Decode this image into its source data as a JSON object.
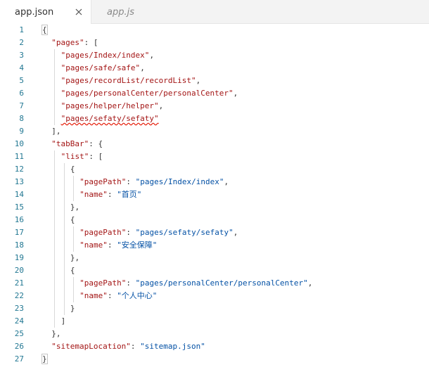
{
  "tabs": [
    {
      "label": "app.json",
      "active": true
    },
    {
      "label": "app.js",
      "active": false
    }
  ],
  "lines": [
    {
      "n": "1",
      "indent": 0,
      "tokens": [
        {
          "t": "{",
          "c": "punc",
          "box": true
        }
      ]
    },
    {
      "n": "2",
      "indent": 1,
      "tokens": [
        {
          "t": "\"pages\"",
          "c": "key"
        },
        {
          "t": ": [",
          "c": "punc"
        }
      ]
    },
    {
      "n": "3",
      "indent": 2,
      "tokens": [
        {
          "t": "\"pages/Index/index\"",
          "c": "key"
        },
        {
          "t": ",",
          "c": "punc"
        }
      ]
    },
    {
      "n": "4",
      "indent": 2,
      "tokens": [
        {
          "t": "\"pages/safe/safe\"",
          "c": "key"
        },
        {
          "t": ",",
          "c": "punc"
        }
      ]
    },
    {
      "n": "5",
      "indent": 2,
      "tokens": [
        {
          "t": "\"pages/recordList/recordList\"",
          "c": "key"
        },
        {
          "t": ",",
          "c": "punc"
        }
      ]
    },
    {
      "n": "6",
      "indent": 2,
      "tokens": [
        {
          "t": "\"pages/personalCenter/personalCenter\"",
          "c": "key"
        },
        {
          "t": ",",
          "c": "punc"
        }
      ]
    },
    {
      "n": "7",
      "indent": 2,
      "tokens": [
        {
          "t": "\"pages/helper/helper\"",
          "c": "key"
        },
        {
          "t": ",",
          "c": "punc"
        }
      ]
    },
    {
      "n": "8",
      "indent": 2,
      "tokens": [
        {
          "t": "\"pages/sefaty/sefaty\"",
          "c": "key",
          "squiggle": true
        }
      ]
    },
    {
      "n": "9",
      "indent": 1,
      "tokens": [
        {
          "t": "],",
          "c": "punc"
        }
      ]
    },
    {
      "n": "10",
      "indent": 1,
      "tokens": [
        {
          "t": "\"tabBar\"",
          "c": "key"
        },
        {
          "t": ": {",
          "c": "punc"
        }
      ]
    },
    {
      "n": "11",
      "indent": 2,
      "tokens": [
        {
          "t": "\"list\"",
          "c": "key"
        },
        {
          "t": ": [",
          "c": "punc"
        }
      ]
    },
    {
      "n": "12",
      "indent": 3,
      "tokens": [
        {
          "t": "{",
          "c": "punc"
        }
      ]
    },
    {
      "n": "13",
      "indent": 4,
      "tokens": [
        {
          "t": "\"pagePath\"",
          "c": "key"
        },
        {
          "t": ": ",
          "c": "punc"
        },
        {
          "t": "\"pages/Index/index\"",
          "c": "str"
        },
        {
          "t": ",",
          "c": "punc"
        }
      ]
    },
    {
      "n": "14",
      "indent": 4,
      "tokens": [
        {
          "t": "\"name\"",
          "c": "key"
        },
        {
          "t": ": ",
          "c": "punc"
        },
        {
          "t": "\"首页\"",
          "c": "str"
        }
      ]
    },
    {
      "n": "15",
      "indent": 3,
      "tokens": [
        {
          "t": "},",
          "c": "punc"
        }
      ]
    },
    {
      "n": "16",
      "indent": 3,
      "tokens": [
        {
          "t": "{",
          "c": "punc"
        }
      ]
    },
    {
      "n": "17",
      "indent": 4,
      "tokens": [
        {
          "t": "\"pagePath\"",
          "c": "key"
        },
        {
          "t": ": ",
          "c": "punc"
        },
        {
          "t": "\"pages/sefaty/sefaty\"",
          "c": "str"
        },
        {
          "t": ",",
          "c": "punc"
        }
      ]
    },
    {
      "n": "18",
      "indent": 4,
      "tokens": [
        {
          "t": "\"name\"",
          "c": "key"
        },
        {
          "t": ": ",
          "c": "punc"
        },
        {
          "t": "\"安全保障\"",
          "c": "str"
        }
      ]
    },
    {
      "n": "19",
      "indent": 3,
      "tokens": [
        {
          "t": "},",
          "c": "punc"
        }
      ]
    },
    {
      "n": "20",
      "indent": 3,
      "tokens": [
        {
          "t": "{",
          "c": "punc"
        }
      ]
    },
    {
      "n": "21",
      "indent": 4,
      "tokens": [
        {
          "t": "\"pagePath\"",
          "c": "key"
        },
        {
          "t": ": ",
          "c": "punc"
        },
        {
          "t": "\"pages/personalCenter/personalCenter\"",
          "c": "str"
        },
        {
          "t": ",",
          "c": "punc"
        }
      ]
    },
    {
      "n": "22",
      "indent": 4,
      "tokens": [
        {
          "t": "\"name\"",
          "c": "key"
        },
        {
          "t": ": ",
          "c": "punc"
        },
        {
          "t": "\"个人中心\"",
          "c": "str"
        }
      ]
    },
    {
      "n": "23",
      "indent": 3,
      "tokens": [
        {
          "t": "}",
          "c": "punc"
        }
      ]
    },
    {
      "n": "24",
      "indent": 2,
      "tokens": [
        {
          "t": "]",
          "c": "punc"
        }
      ]
    },
    {
      "n": "25",
      "indent": 1,
      "tokens": [
        {
          "t": "},",
          "c": "punc"
        }
      ]
    },
    {
      "n": "26",
      "indent": 1,
      "tokens": [
        {
          "t": "\"sitemapLocation\"",
          "c": "key"
        },
        {
          "t": ": ",
          "c": "punc"
        },
        {
          "t": "\"sitemap.json\"",
          "c": "str"
        }
      ]
    },
    {
      "n": "27",
      "indent": 0,
      "tokens": [
        {
          "t": "}",
          "c": "punc",
          "box": true
        }
      ]
    }
  ],
  "icons": {
    "close_tab": "close-icon"
  },
  "colors": {
    "line_number": "#237893",
    "key": "#a31515",
    "string": "#0451a5",
    "error_squiggle": "#e51400"
  }
}
